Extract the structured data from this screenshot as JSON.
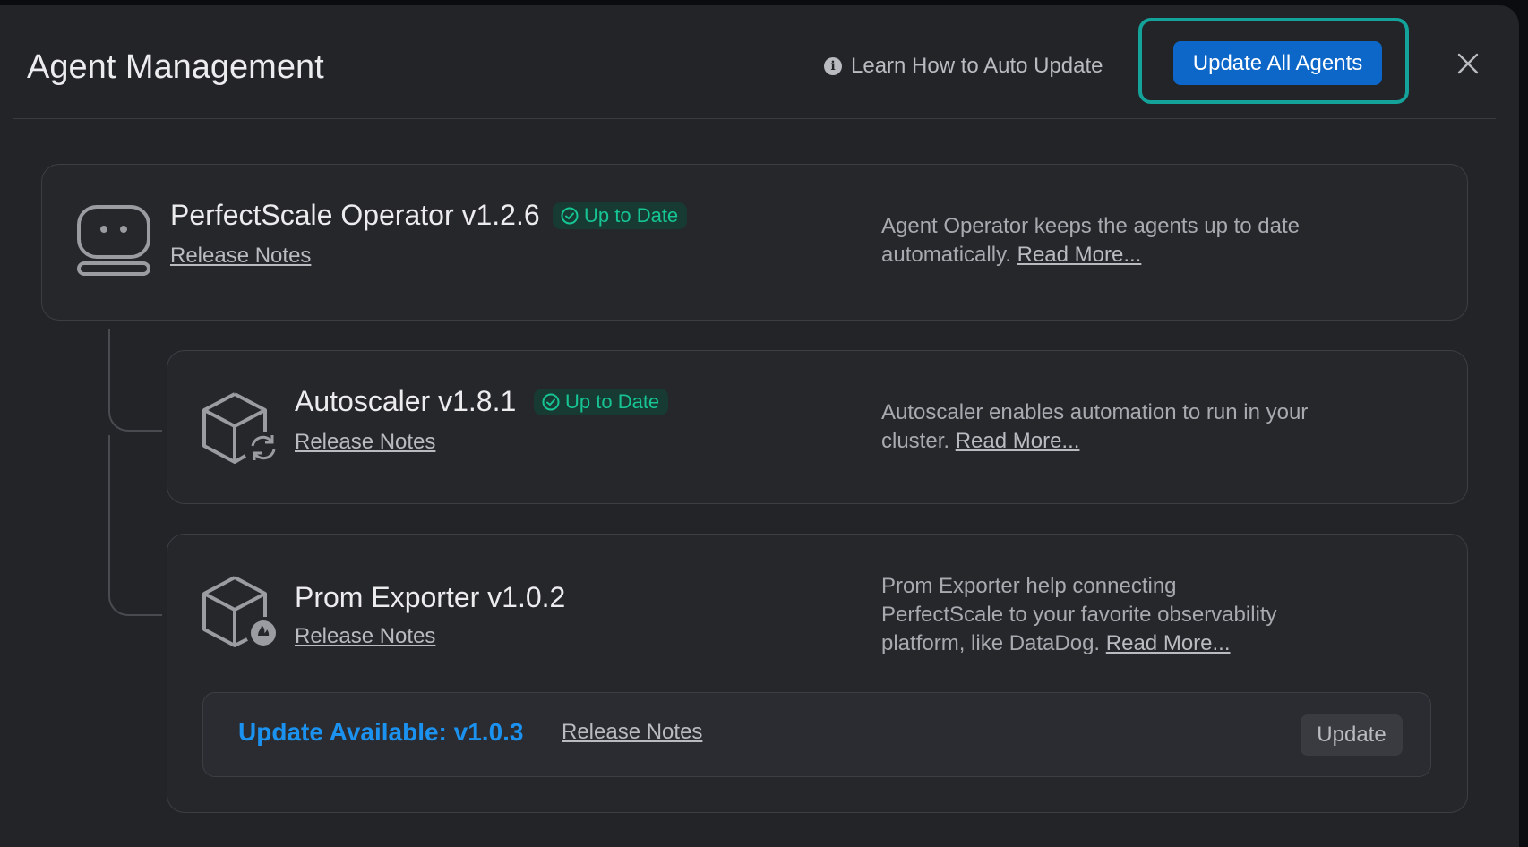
{
  "header": {
    "title": "Agent Management",
    "learn_link": "Learn How to Auto Update",
    "update_all_label": "Update All Agents",
    "info_glyph": "i"
  },
  "agents": [
    {
      "name": "PerfectScale Operator v1.2.6",
      "status": "Up to Date",
      "release_notes": "Release Notes",
      "description": "Agent Operator keeps the agents up to date automatically.",
      "read_more": "Read More...",
      "icon": "robot-icon"
    },
    {
      "name": "Autoscaler v1.8.1",
      "status": "Up to Date",
      "release_notes": "Release Notes",
      "description": "Autoscaler enables automation to run in your cluster.",
      "read_more": "Read More...",
      "icon": "cube-refresh-icon"
    },
    {
      "name": "Prom Exporter v1.0.2",
      "release_notes": "Release Notes",
      "description": "Prom Exporter help connecting PerfectScale to your favorite observability platform, like DataDog.",
      "read_more": "Read More...",
      "icon": "cube-flame-icon",
      "update": {
        "text": "Update Available: v1.0.3",
        "release_notes": "Release Notes",
        "button": "Update"
      }
    }
  ],
  "colors": {
    "panel": "#232428",
    "accent_blue": "#0c67c8",
    "focus_ring": "#13a39a",
    "status_green": "#17c494",
    "update_blue": "#1b92ef"
  }
}
